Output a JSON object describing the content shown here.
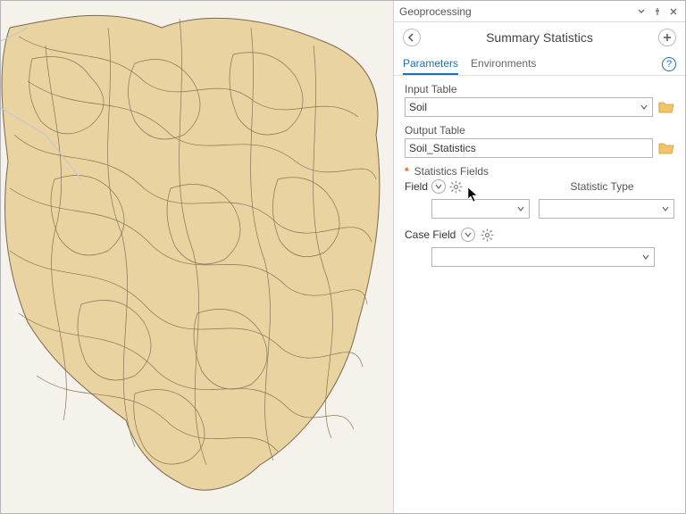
{
  "panel": {
    "title": "Geoprocessing"
  },
  "tool": {
    "title": "Summary Statistics"
  },
  "tabs": {
    "active": "Parameters",
    "other": "Environments"
  },
  "params": {
    "input_label": "Input Table",
    "input_value": "Soil",
    "output_label": "Output Table",
    "output_value": "Soil_Statistics",
    "stats_label": "Statistics Fields",
    "field_header": "Field",
    "type_header": "Statistic Type",
    "case_label": "Case Field"
  }
}
